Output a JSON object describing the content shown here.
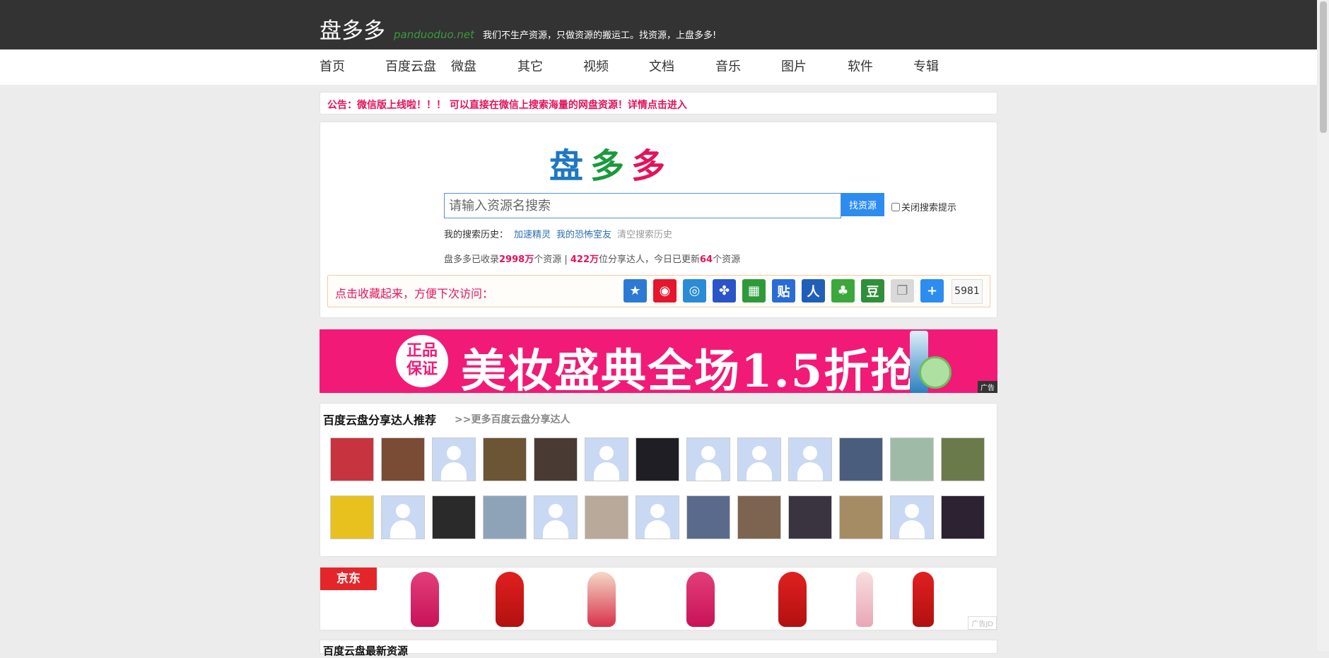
{
  "header": {
    "logo": "盘多多",
    "domain": "panduoduo.net",
    "slogan": "我们不生产资源，只做资源的搬运工。找资源，上盘多多!"
  },
  "nav": [
    "首页",
    "百度云盘",
    "微盘",
    "其它",
    "视频",
    "文档",
    "音乐",
    "图片",
    "软件",
    "专辑"
  ],
  "notice": "公告：微信版上线啦！！！ 可以直接在微信上搜索海量的网盘资源！详情点击进入",
  "search": {
    "title_chars": [
      "盘",
      "多",
      "多"
    ],
    "placeholder": "请输入资源名搜索",
    "button": "找资源",
    "toggle_label": "关闭搜索提示",
    "history_label": "我的搜索历史：",
    "history_items": [
      "加速精灵",
      "我的恐怖室友"
    ],
    "clear_history": "清空搜索历史"
  },
  "stats": {
    "prefix": "盘多多已收录",
    "resources": "2998万",
    "mid1": "个资源 | ",
    "sharers": "422万",
    "mid2": "位分享达人，今日已更新",
    "today": "64",
    "suffix": "个资源"
  },
  "share": {
    "label": "点击收藏起来，方便下次访问：",
    "icons": [
      {
        "name": "qzone-icon",
        "glyph": "★",
        "color": "#2d7ad4"
      },
      {
        "name": "weibo-icon",
        "glyph": "◉",
        "color": "#e6162d"
      },
      {
        "name": "tencent-weibo-icon",
        "glyph": "◎",
        "color": "#2a8bd6"
      },
      {
        "name": "baidu-icon",
        "glyph": "✤",
        "color": "#2a54c9"
      },
      {
        "name": "baidu-space-icon",
        "glyph": "▦",
        "color": "#2e9a3a"
      },
      {
        "name": "tieba-icon",
        "glyph": "贴",
        "color": "#2a6cd6"
      },
      {
        "name": "renren-icon",
        "glyph": "人",
        "color": "#1f5fb8"
      },
      {
        "name": "kaixin-icon",
        "glyph": "♣",
        "color": "#3aa83a"
      },
      {
        "name": "douban-icon",
        "glyph": "豆",
        "color": "#2f8f3a"
      },
      {
        "name": "copy-icon",
        "glyph": "❐",
        "color": "#d9d9d9"
      },
      {
        "name": "more-icon",
        "glyph": "+",
        "color": "#2d8cf0"
      }
    ],
    "count": "5981"
  },
  "ad1": {
    "seal": "正品\n保证",
    "headline": "美妆盛典全场1.5折抢",
    "tag": "广告"
  },
  "experts": {
    "heading": "百度云盘分享达人推荐",
    "more_link": ">>更多百度云盘分享达人",
    "avatars": [
      {
        "type": "photo",
        "color": "#c7333f"
      },
      {
        "type": "photo",
        "color": "#7a4b35"
      },
      {
        "type": "default"
      },
      {
        "type": "photo",
        "color": "#6b5535"
      },
      {
        "type": "photo",
        "color": "#4a3a34"
      },
      {
        "type": "default"
      },
      {
        "type": "photo",
        "color": "#1e1e24"
      },
      {
        "type": "default"
      },
      {
        "type": "default"
      },
      {
        "type": "default"
      },
      {
        "type": "photo",
        "color": "#4b5d7d"
      },
      {
        "type": "photo",
        "color": "#9fbba8"
      },
      {
        "type": "photo",
        "color": "#6b7a4a"
      },
      {
        "type": "photo",
        "color": "#e8c11f"
      },
      {
        "type": "default"
      },
      {
        "type": "photo",
        "color": "#2a2a2a"
      },
      {
        "type": "photo",
        "color": "#8fa3b8"
      },
      {
        "type": "default"
      },
      {
        "type": "photo",
        "color": "#b8a99a"
      },
      {
        "type": "default"
      },
      {
        "type": "photo",
        "color": "#5a6a8c"
      },
      {
        "type": "photo",
        "color": "#7c6450"
      },
      {
        "type": "photo",
        "color": "#3a3440"
      },
      {
        "type": "photo",
        "color": "#a58c64"
      },
      {
        "type": "default"
      },
      {
        "type": "photo",
        "color": "#2c2232"
      }
    ]
  },
  "ad2": {
    "brand": "京东",
    "tag": "广告JD"
  },
  "next_section": "百度云盘最新资源"
}
